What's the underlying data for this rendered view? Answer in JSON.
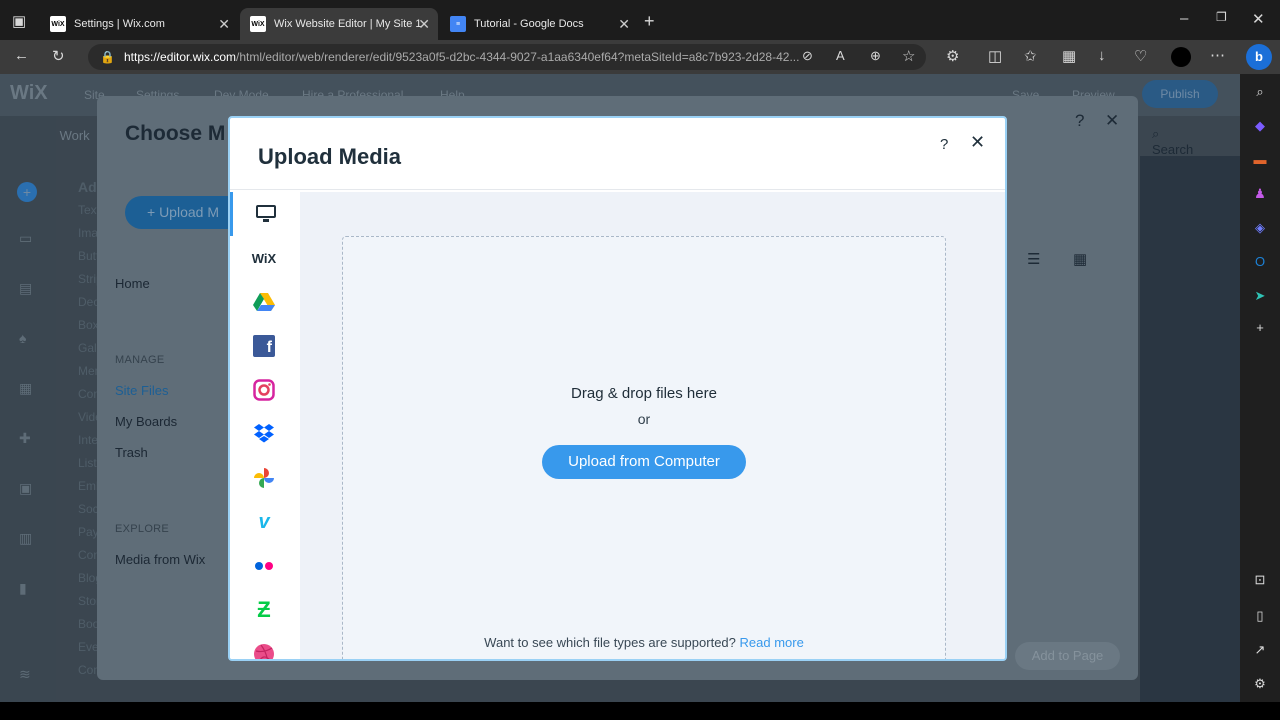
{
  "browser": {
    "tabs": [
      {
        "title": "Settings | Wix.com",
        "icon": "wix-favicon"
      },
      {
        "title": "Wix Website Editor | My Site 1",
        "icon": "wix-favicon"
      },
      {
        "title": "Tutorial - Google Docs",
        "icon": "google-docs-favicon"
      }
    ],
    "url_domain": "https://editor.wix.com",
    "url_path": "/html/editor/web/renderer/edit/9523a0f5-d2bc-4344-9027-a1aa6340ef64?metaSiteId=a8c7b923-2d28-42..."
  },
  "editor": {
    "logo": "WiX",
    "nav": [
      "Site",
      "Settings",
      "Dev Mode",
      "Hire a Professional",
      "Help"
    ],
    "page_label": "Page: Work",
    "right_actions": [
      "Save",
      "Preview"
    ],
    "publish": "Publish",
    "left_items": [
      "Add",
      "Text",
      "Image",
      "Button",
      "Strip",
      "Decorative",
      "Box",
      "Gallery",
      "Menu",
      "Contact",
      "Video",
      "Interactive",
      "List",
      "Embed",
      "Social",
      "Payments",
      "Content",
      "Blog",
      "Store",
      "Bookings",
      "Events",
      "Community"
    ]
  },
  "choose_media": {
    "title": "Choose M",
    "upload_button": "+ Upload M",
    "nav_home": "Home",
    "manage_heading": "MANAGE",
    "manage_items": [
      "Site Files",
      "My Boards",
      "Trash"
    ],
    "explore_heading": "EXPLORE",
    "explore_items": [
      "Media from Wix"
    ],
    "search_label": "Search",
    "add_to_page": "Add to Page"
  },
  "upload_media": {
    "title": "Upload Media",
    "help_glyph": "?",
    "close_glyph": "✕",
    "sources": [
      "computer",
      "wix",
      "google-drive",
      "facebook",
      "instagram",
      "dropbox",
      "google-photos",
      "vimeo",
      "flickr",
      "deviantart",
      "dribbble"
    ],
    "drop_text": "Drag & drop files here",
    "or_text": "or",
    "upload_button": "Upload from Computer",
    "footer_text": "Want to see which file types are supported?",
    "footer_link": "Read more",
    "accent": "#3899ec"
  }
}
